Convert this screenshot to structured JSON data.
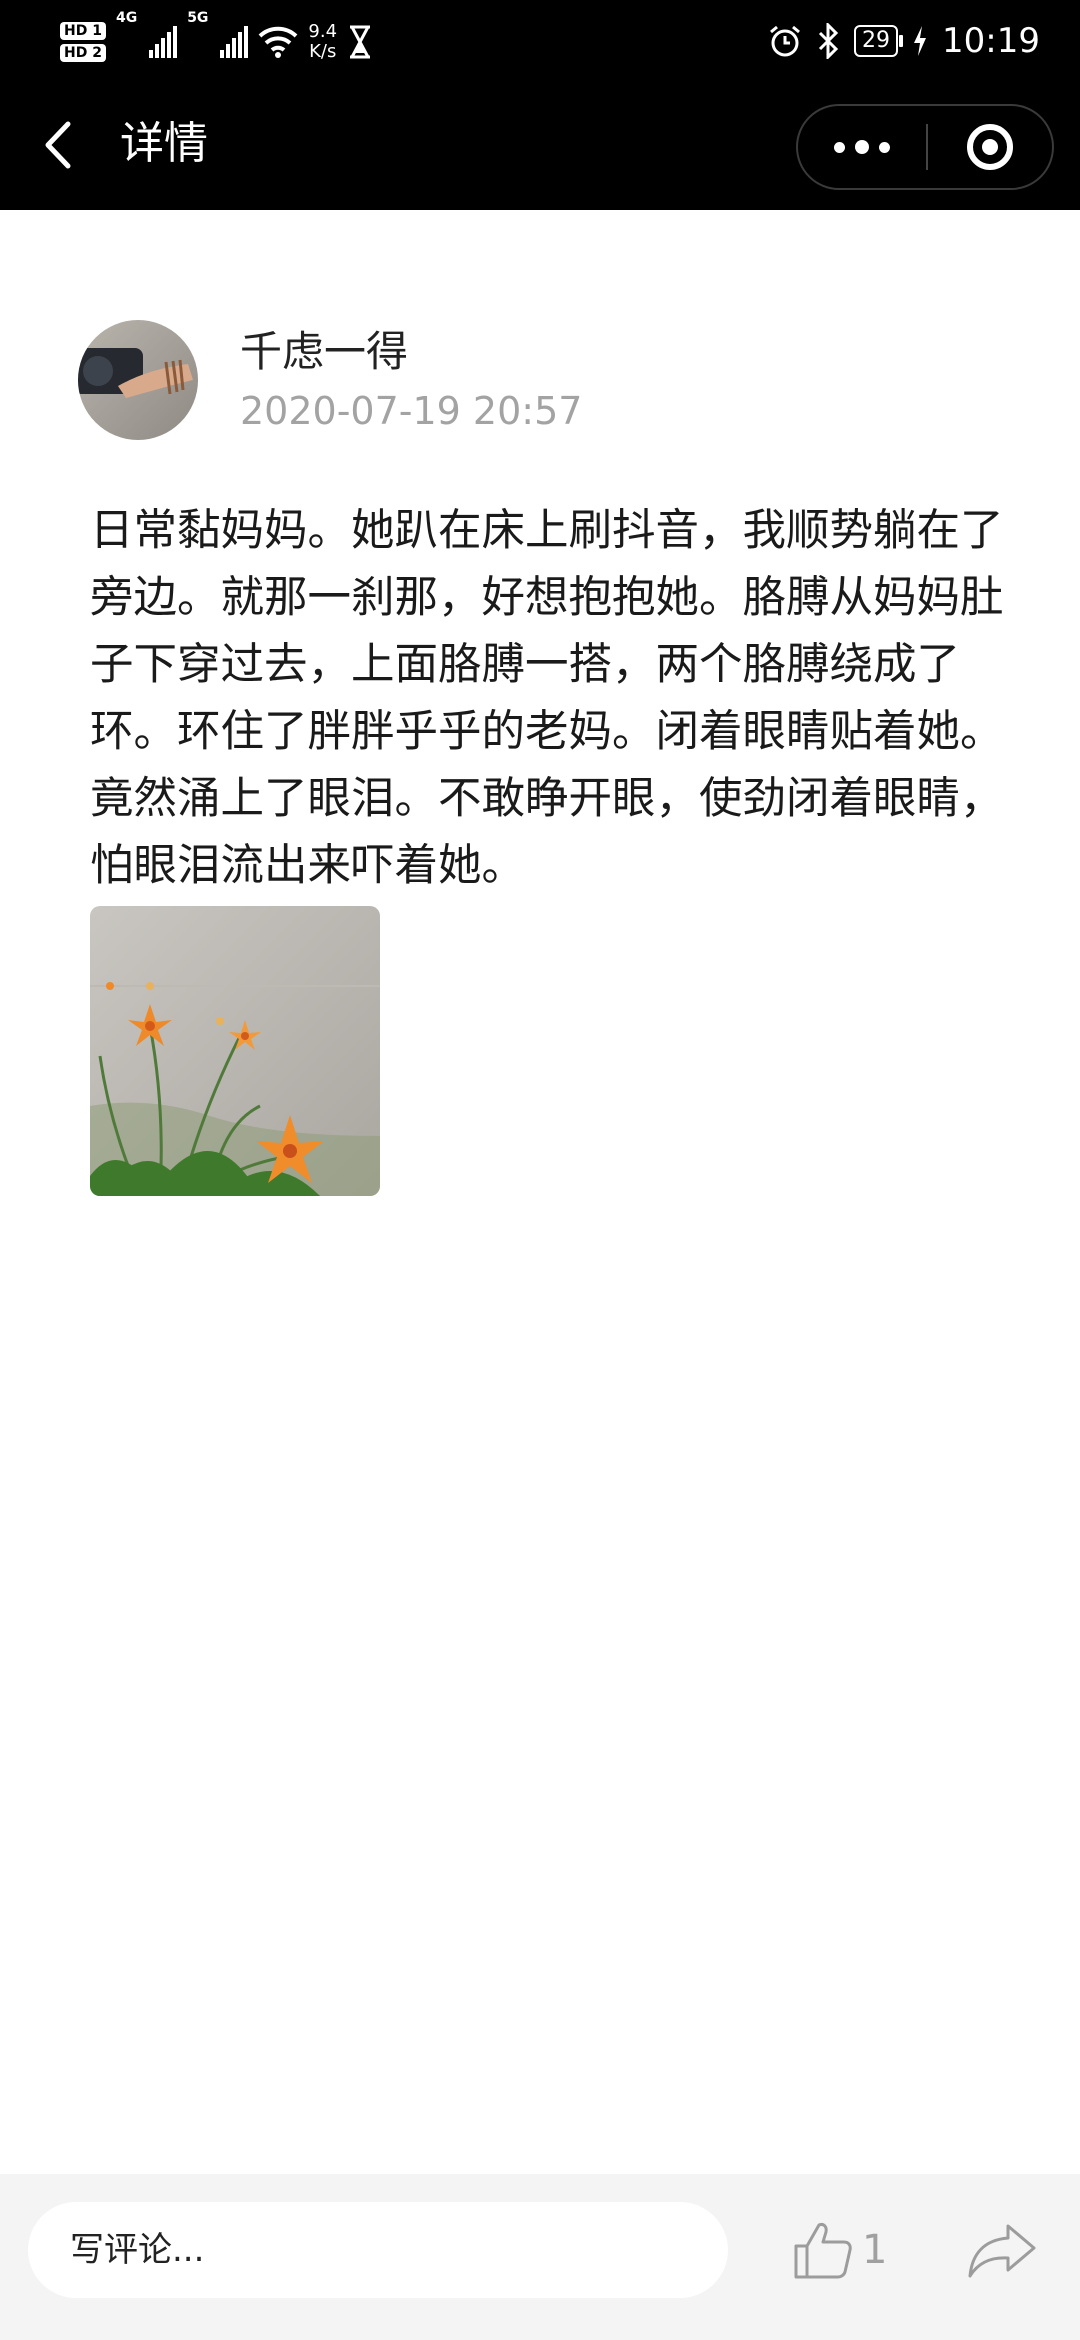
{
  "status_bar": {
    "sim1_label": "HD 1",
    "sim2_label": "HD 2",
    "net1": "4G",
    "net2": "5G",
    "speed_value": "9.4",
    "speed_unit": "K/s",
    "battery": "29",
    "time": "10:19",
    "icons": [
      "hourglass-icon",
      "alarm-icon",
      "bluetooth-icon",
      "charging-icon",
      "wifi-icon"
    ]
  },
  "nav": {
    "title": "详情",
    "back_icon": "chevron-left-icon",
    "more_icon": "more-dots-icon",
    "close_icon": "target-circle-icon"
  },
  "post": {
    "author": "千虑一得",
    "time": "2020-07-19 20:57",
    "body": "日常黏妈妈。她趴在床上刷抖音，我顺势躺在了旁边。就那一刹那，好想抱抱她。胳膊从妈妈肚子下穿过去，上面胳膊一搭，两个胳膊绕成了环。环住了胖胖乎乎的老妈。闭着眼睛贴着她。竟然涌上了眼泪。不敢睁开眼，使劲闭着眼睛，怕眼泪流出来吓着她。"
  },
  "bottom": {
    "comment_placeholder": "写评论...",
    "like_count": "1",
    "like_icon": "thumbs-up-icon",
    "share_icon": "share-arrow-icon"
  },
  "colors": {
    "header_bg": "#000000",
    "bottom_bg": "#f4f4f4",
    "muted_text": "#a3a3a3"
  }
}
